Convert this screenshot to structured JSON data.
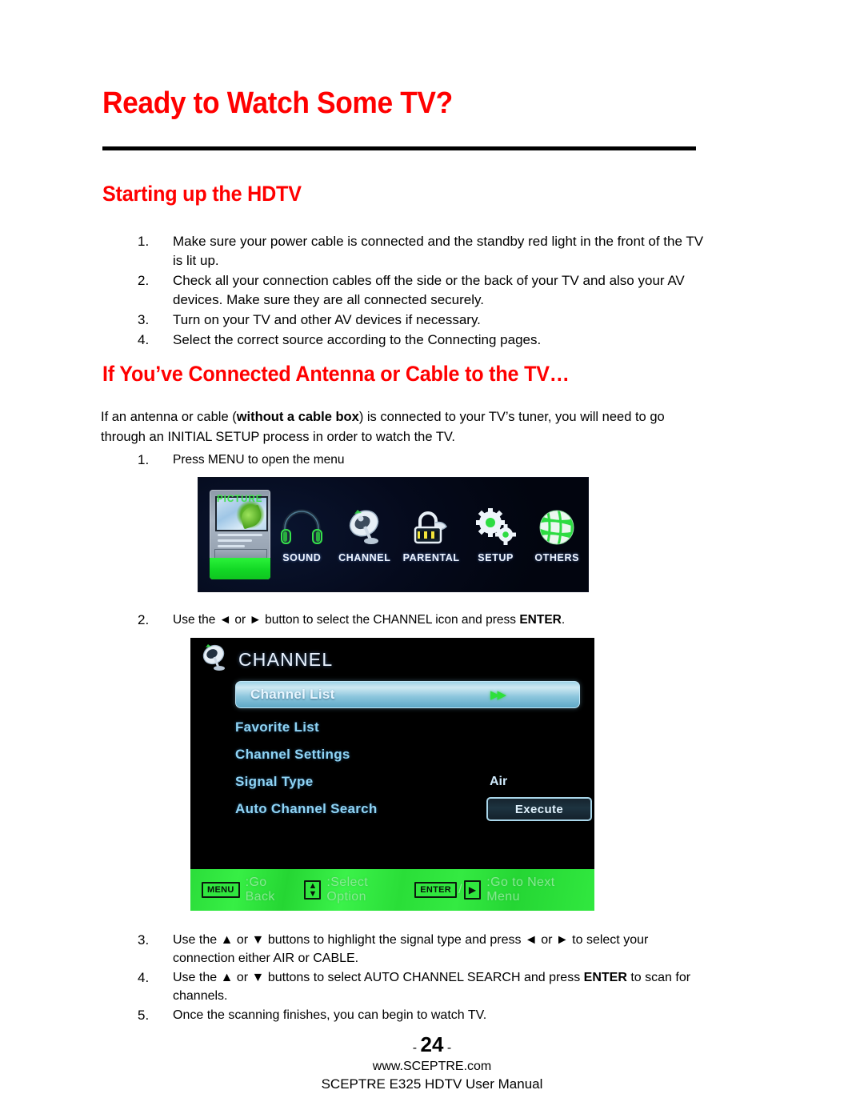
{
  "page": {
    "title": "Ready to Watch Some TV?",
    "section1_heading": "Starting up the HDTV",
    "section2_heading": "If You’ve Connected Antenna or Cable to the TV…"
  },
  "startup_steps": [
    {
      "num": "1.",
      "text": "Make sure your power cable is connected and the standby red light in the front of the TV is lit up."
    },
    {
      "num": "2.",
      "text": "Check all your connection cables off the side or the back of your TV and also your AV devices.  Make sure they are all connected securely."
    },
    {
      "num": "3.",
      "text": "Turn on your TV and other AV devices if necessary."
    },
    {
      "num": "4.",
      "text": "Select the correct source according to the Connecting pages."
    }
  ],
  "intro_paragraph": {
    "before_bold": "If an antenna or cable (",
    "bold": "without a cable box",
    "after_bold": ") is connected to your TV’s tuner, you will need to go through an INITIAL SETUP process in order to watch the TV."
  },
  "setup_steps": {
    "step1": {
      "num": "1.",
      "text": "Press MENU to open the menu"
    },
    "step2": {
      "num": "2.",
      "part1": "Use the ◄ or ► button to select the CHANNEL icon and press ",
      "bold": "ENTER",
      "part2": "."
    },
    "step3": {
      "num": "3.",
      "text": "Use the ▲ or ▼ buttons to highlight the signal type and press ◄ or ► to select your connection either AIR or CABLE."
    },
    "step4": {
      "num": "4.",
      "part1": "Use the ▲ or ▼ buttons to select AUTO CHANNEL SEARCH and press ",
      "bold": "ENTER",
      "part2": " to scan for channels."
    },
    "step5": {
      "num": "5.",
      "text": "Once the scanning finishes, you can begin to watch TV."
    }
  },
  "main_menu": {
    "items": [
      {
        "label": "PICTURE",
        "icon": "picture-icon",
        "selected": true
      },
      {
        "label": "SOUND",
        "icon": "headphones-icon",
        "selected": false
      },
      {
        "label": "CHANNEL",
        "icon": "satellite-dish-icon",
        "selected": false
      },
      {
        "label": "PARENTAL",
        "icon": "padlock-icon",
        "selected": false
      },
      {
        "label": "SETUP",
        "icon": "gears-icon",
        "selected": false
      },
      {
        "label": "OTHERS",
        "icon": "globe-icon",
        "selected": false
      }
    ]
  },
  "channel_menu": {
    "title": "CHANNEL",
    "icon": "satellite-dish-icon",
    "rows": [
      {
        "label": "Channel List",
        "value": "",
        "arrows": "▶▶",
        "selected": true,
        "button": ""
      },
      {
        "label": "Favorite List",
        "value": "",
        "arrows": "",
        "selected": false,
        "button": ""
      },
      {
        "label": "Channel Settings",
        "value": "",
        "arrows": "",
        "selected": false,
        "button": ""
      },
      {
        "label": "Signal Type",
        "value": "Air",
        "arrows": "",
        "selected": false,
        "button": ""
      },
      {
        "label": "Auto Channel Search",
        "value": "",
        "arrows": "",
        "selected": false,
        "button": "Execute"
      }
    ],
    "footer": {
      "menu_key": "MENU",
      "menu_action": ":Go Back",
      "updown_action": ":Select Option",
      "enter_key": "ENTER",
      "slash": "/",
      "right_arrow": "▶",
      "enter_action": ":Go to Next Menu",
      "up_glyph": "▲",
      "down_glyph": "▼"
    }
  },
  "footer": {
    "page_prefix": "- ",
    "page_number": "24",
    "page_suffix": " -",
    "website": "www.SCEPTRE.com",
    "manual": "SCEPTRE E325 HDTV User Manual"
  },
  "colors": {
    "heading_red": "#ff0000",
    "highlight_green": "#2bf23a",
    "menu_blue": "#8fd4f5"
  }
}
